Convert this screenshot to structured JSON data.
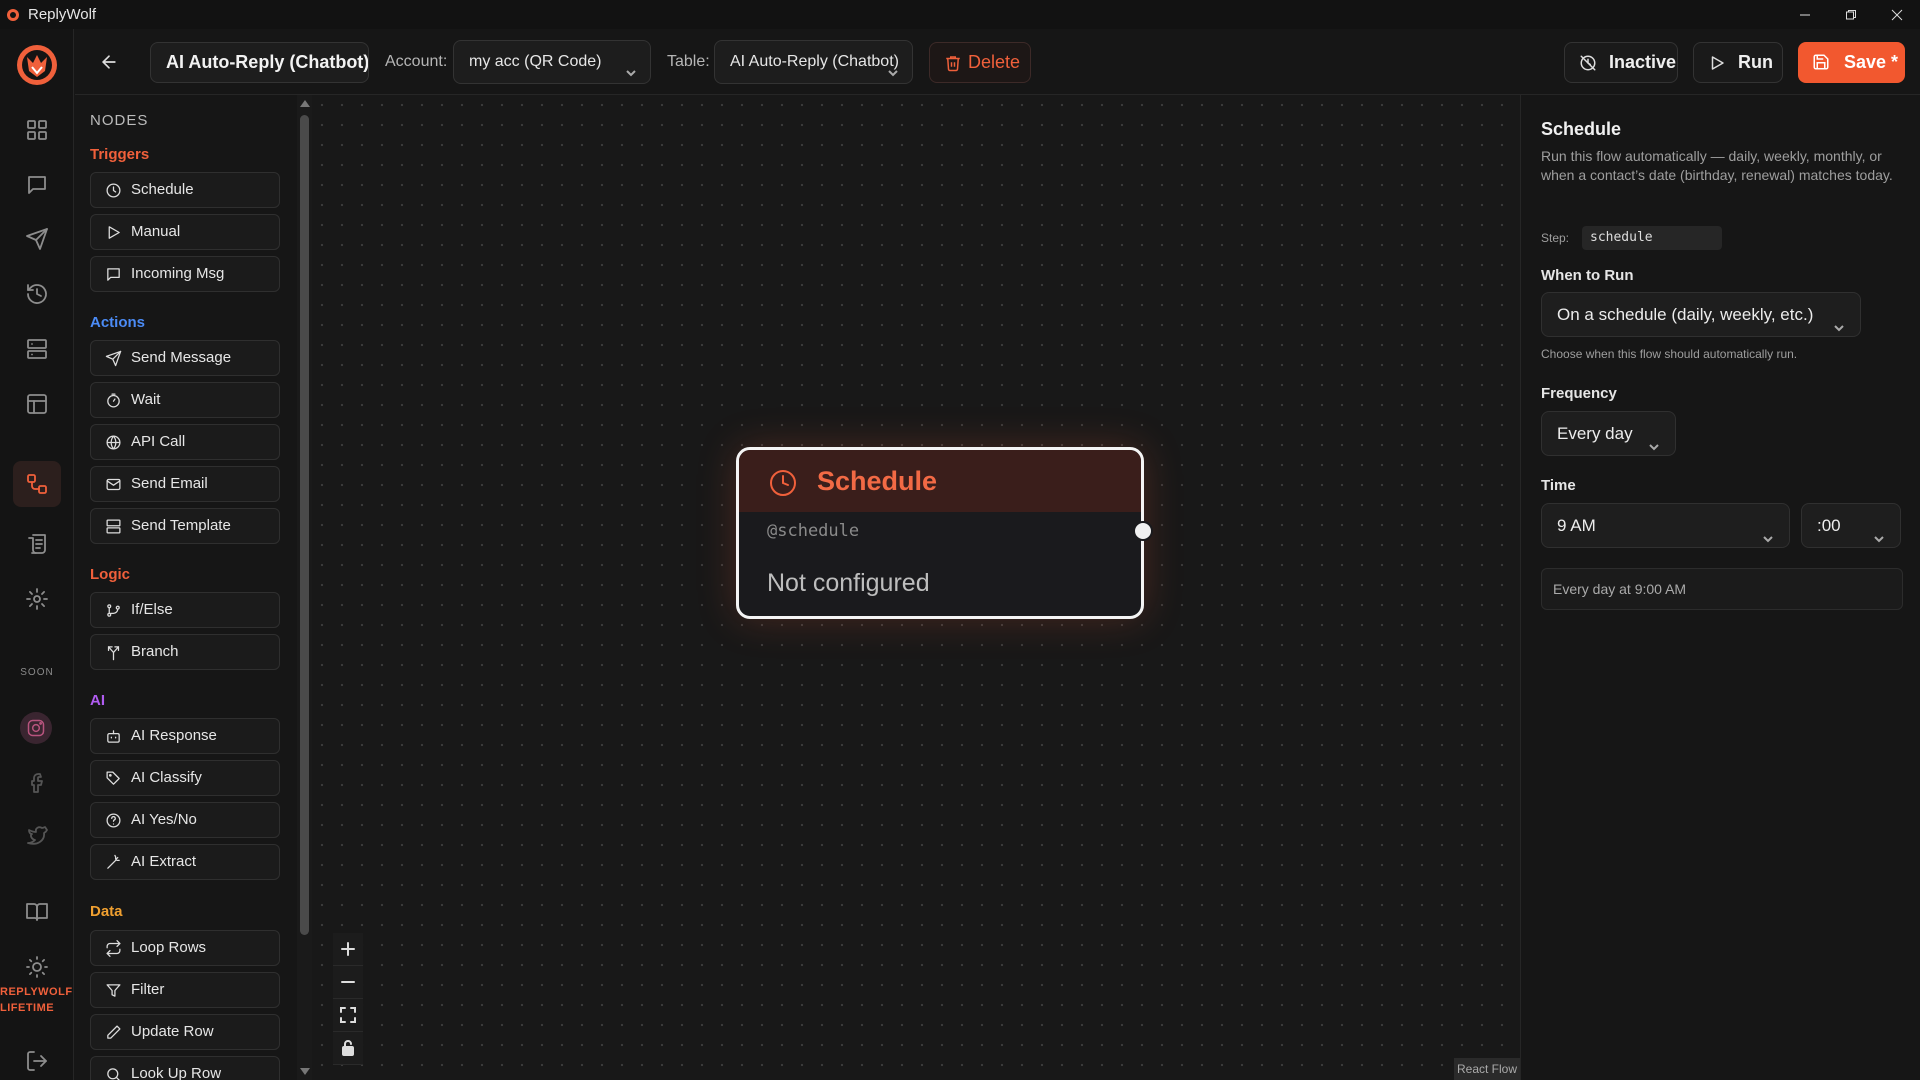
{
  "window": {
    "title": "ReplyWolf",
    "controls": [
      "minimize",
      "restore",
      "close"
    ]
  },
  "rail": {
    "items": [
      {
        "icon": "dashboard-icon",
        "active": false
      },
      {
        "icon": "chat-icon",
        "active": false
      },
      {
        "icon": "send-icon",
        "active": false
      },
      {
        "icon": "history-icon",
        "active": false
      },
      {
        "icon": "layout-icon",
        "active": false
      },
      {
        "icon": "table-icon",
        "active": false
      },
      {
        "icon": "workflow-icon",
        "active": true
      },
      {
        "icon": "logs-icon",
        "active": false
      },
      {
        "icon": "settings-icon",
        "active": false
      }
    ],
    "soon_label": "SOON",
    "brand_line1": "REPLYWOLF",
    "brand_line2": "LIFETIME"
  },
  "toolbar": {
    "flow_name": "AI Auto-Reply (Chatbot)",
    "account_label": "Account:",
    "account_value": "my acc (QR Code)",
    "table_label": "Table:",
    "table_value": "AI Auto-Reply (Chatbot)",
    "delete_label": "Delete",
    "inactive_label": "Inactive",
    "run_label": "Run",
    "save_label": "Save *"
  },
  "nodes_panel": {
    "title": "NODES",
    "sections": [
      {
        "name": "Triggers",
        "color": "#f0603b",
        "items": [
          "Schedule",
          "Manual",
          "Incoming Msg"
        ]
      },
      {
        "name": "Actions",
        "color": "#4b8bf5",
        "items": [
          "Send Message",
          "Wait",
          "API Call",
          "Send Email",
          "Send Template"
        ]
      },
      {
        "name": "Logic",
        "color": "#f0603b",
        "items": [
          "If/Else",
          "Branch"
        ]
      },
      {
        "name": "AI",
        "color": "#b05cf0",
        "items": [
          "AI Response",
          "AI Classify",
          "AI Yes/No",
          "AI Extract"
        ]
      },
      {
        "name": "Data",
        "color": "#f0a030",
        "items": [
          "Loop Rows",
          "Filter",
          "Update Row",
          "Look Up Row"
        ]
      }
    ]
  },
  "canvas": {
    "node": {
      "title": "Schedule",
      "key": "@schedule",
      "status": "Not configured"
    },
    "attribution": "React Flow"
  },
  "properties": {
    "title": "Schedule",
    "description": "Run this flow automatically — daily, weekly, monthly, or when a contact’s date (birthday, renewal) matches today.",
    "step_label": "Step:",
    "step_value": "schedule",
    "when_label": "When to Run",
    "when_value": "On a schedule (daily, weekly, etc.)",
    "when_help": "Choose when this flow should automatically run.",
    "frequency_label": "Frequency",
    "frequency_value": "Every day",
    "time_label": "Time",
    "hour_value": "9 AM",
    "minute_value": ":00",
    "summary": "Every day at 9:00 AM"
  }
}
